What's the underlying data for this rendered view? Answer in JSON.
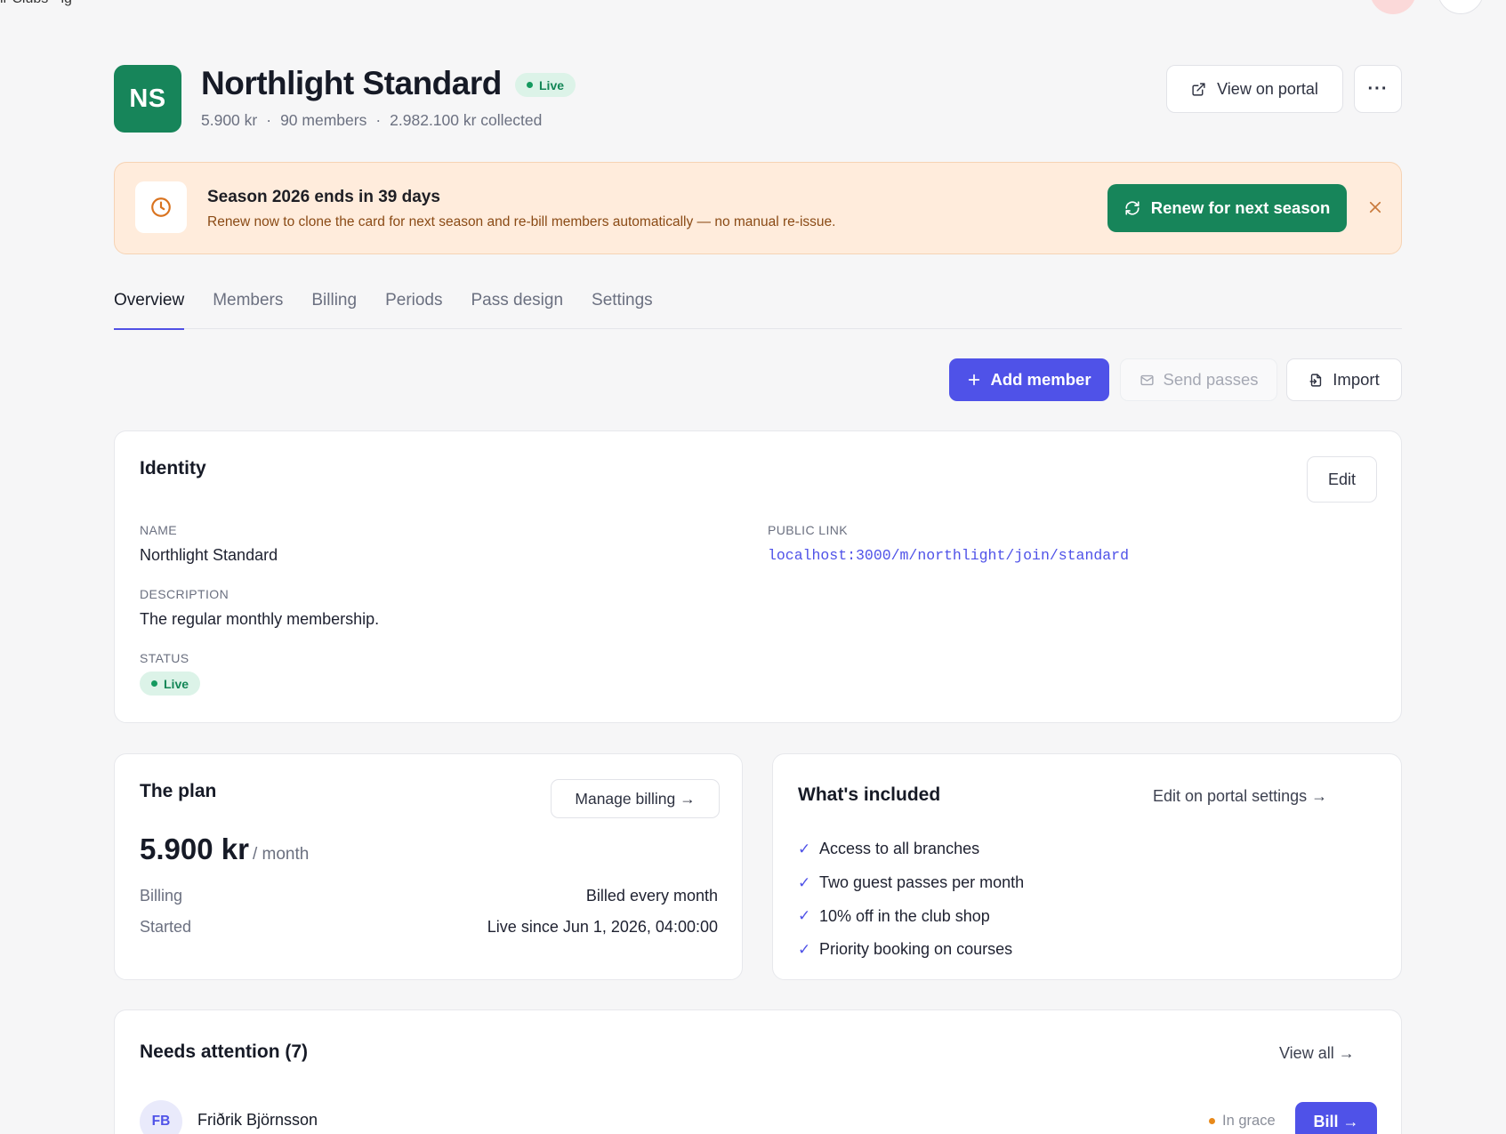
{
  "topbar": {
    "fragment": "ir Clubs  ·  ig"
  },
  "header": {
    "initials": "NS",
    "title": "Northlight Standard",
    "status": "Live",
    "meta": {
      "price": "5.900 kr",
      "members": "90 members",
      "collected": "2.982.100 kr collected",
      "separator": "·"
    },
    "view_portal_label": "View on portal",
    "more_label": "···"
  },
  "banner": {
    "title": "Season 2026 ends in 39 days",
    "subtitle": "Renew now to clone the card for next season and re-bill members automatically — no manual re-issue.",
    "renew_label": "Renew for next season",
    "close_label": "✕"
  },
  "tabs": [
    {
      "label": "Overview",
      "active": true
    },
    {
      "label": "Members"
    },
    {
      "label": "Billing"
    },
    {
      "label": "Periods"
    },
    {
      "label": "Pass design"
    },
    {
      "label": "Settings"
    }
  ],
  "actions": {
    "add_member_label": "Add member",
    "send_passes_label": "Send passes",
    "import_label": "Import"
  },
  "identity": {
    "title": "Identity",
    "edit_label": "Edit",
    "name_label": "Name",
    "name_value": "Northlight Standard",
    "public_link_label": "Public link",
    "public_link_value": "localhost:3000/m/northlight/join/standard",
    "description_label": "Description",
    "description_value": "The regular monthly membership.",
    "status_label": "Status",
    "status_value": "Live"
  },
  "plan": {
    "title": "The plan",
    "manage_label": "Manage billing →",
    "price": "5.900 kr",
    "per": "/ month",
    "billing_label": "Billing",
    "billing_value": "Billed every month",
    "started_label": "Started",
    "started_value": "Live since Jun 1, 2026, 04:00:00"
  },
  "included": {
    "title": "What's included",
    "edit_link": "Edit on portal settings →",
    "items": [
      "Access to all branches",
      "Two guest passes per month",
      "10% off in the club shop",
      "Priority booking on courses"
    ]
  },
  "attention": {
    "title": "Needs attention (7)",
    "view_all": "View all →",
    "rows": [
      {
        "initials": "FB",
        "name": "Friðrik Björnsson",
        "status": "In grace",
        "action": "Bill →"
      }
    ]
  },
  "colors": {
    "brand_green": "#17855a",
    "accent_indigo": "#4f52e8",
    "banner_bg": "#ffecdc",
    "live_bg": "#dcf3e8",
    "grace_orange": "#e8891a"
  }
}
